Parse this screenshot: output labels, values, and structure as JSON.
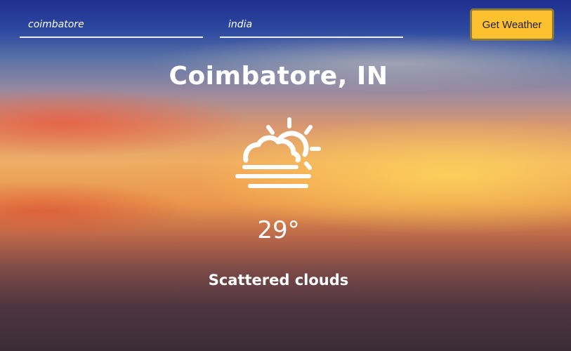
{
  "search": {
    "city_value": "coimbatore",
    "country_value": "india",
    "button_label": "Get Weather"
  },
  "weather": {
    "location": "Coimbatore, IN",
    "icon": "sun-behind-cloud-haze-icon",
    "temperature": "29°",
    "description": "Scattered clouds"
  },
  "colors": {
    "button_bg": "#fdc02f",
    "text": "#ffffff"
  }
}
